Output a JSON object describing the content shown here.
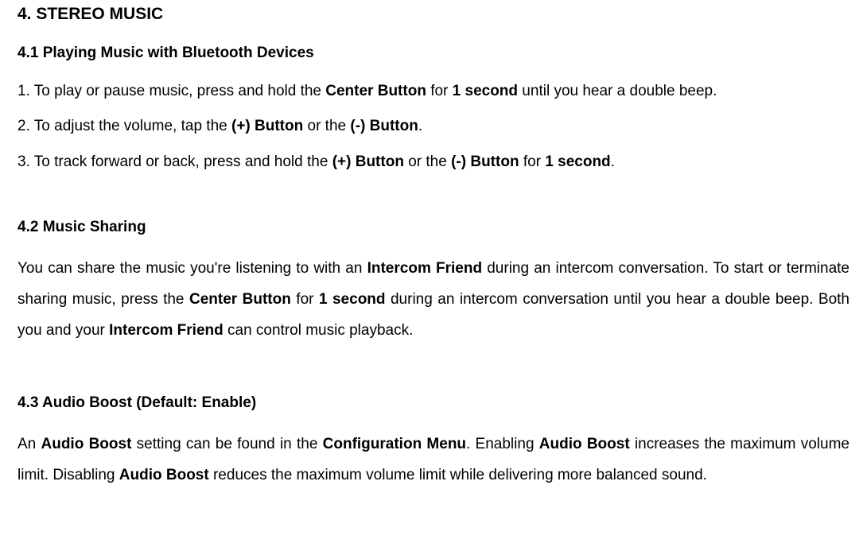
{
  "title": "4. STEREO MUSIC",
  "s41": {
    "heading": "4.1 Playing Music with Bluetooth Devices",
    "l1a": "1. To play or pause music, press and hold the ",
    "l1b": "Center Button",
    "l1c": " for ",
    "l1d": "1 second",
    "l1e": " until you hear a double beep.",
    "l2a": "2. To adjust the volume, tap the ",
    "l2b": "(+) Button",
    "l2c": " or the ",
    "l2d": "(-) Button",
    "l2e": ".",
    "l3a": "3. To track forward or back, press and hold the ",
    "l3b": "(+) Button",
    "l3c": " or the ",
    "l3d": "(-) Button",
    "l3e": " for ",
    "l3f": "1 second",
    "l3g": "."
  },
  "s42": {
    "heading": "4.2 Music Sharing",
    "p1a": "You can share the music you're listening to with an ",
    "p1b": "Intercom Friend",
    "p1c": " during an intercom conversation. To start or terminate sharing music, press the ",
    "p1d": "Center Button",
    "p1e": " for ",
    "p1f": "1 second",
    "p1g": " during an intercom conversation until you hear a double beep. Both you and your ",
    "p1h": "Intercom Friend",
    "p1i": " can control music playback."
  },
  "s43": {
    "heading": "4.3 Audio Boost (Default: Enable)",
    "p1a": "An ",
    "p1b": "Audio Boost",
    "p1c": " setting can be found in the ",
    "p1d": "Configuration Menu",
    "p1e": ". Enabling ",
    "p1f": "Audio Boost",
    "p1g": " increases the maximum volume limit. Disabling ",
    "p1h": "Audio Boost",
    "p1i": " reduces the maximum volume limit while delivering more balanced sound."
  }
}
